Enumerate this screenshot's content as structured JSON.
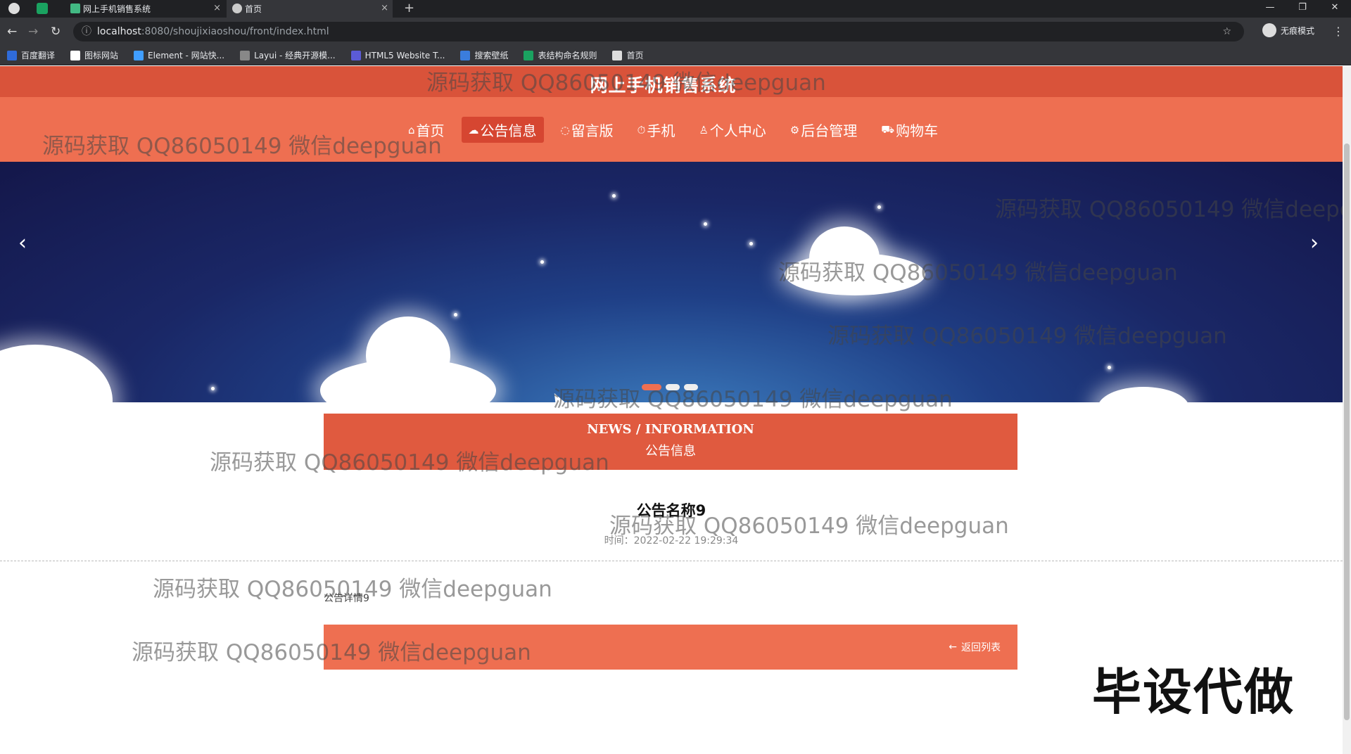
{
  "browser": {
    "tabs": [
      {
        "title": "网上手机销售系统",
        "close": "×"
      },
      {
        "title": "首页",
        "close": "×"
      }
    ],
    "new_tab": "+",
    "url_host": "localhost",
    "url_path": ":8080/shoujixiaoshou/front/index.html",
    "profile_label": "无痕模式",
    "window_controls": [
      "—",
      "❐",
      "✕"
    ],
    "bookmarks": [
      {
        "label": "百度翻译",
        "color": "#2f6bd9"
      },
      {
        "label": "图标网站",
        "color": "#ffffff"
      },
      {
        "label": "Element - 网站快...",
        "color": "#409eff"
      },
      {
        "label": "Layui - 经典开源模...",
        "color": "#888888"
      },
      {
        "label": "HTML5 Website T...",
        "color": "#5b5bd6"
      },
      {
        "label": "搜索壁纸",
        "color": "#3b7ddd"
      },
      {
        "label": "表结构命名规则",
        "color": "#1aa260"
      },
      {
        "label": "首页",
        "color": "#dddddd"
      }
    ]
  },
  "site": {
    "title": "网上手机销售系统",
    "nav": [
      {
        "icon": "⌂",
        "label": "首页",
        "active": false
      },
      {
        "icon": "☁",
        "label": "公告信息",
        "active": true
      },
      {
        "icon": "◌",
        "label": "留言版",
        "active": false
      },
      {
        "icon": "⏱",
        "label": "手机",
        "active": false
      },
      {
        "icon": "♙",
        "label": "个人中心",
        "active": false
      },
      {
        "icon": "⚙",
        "label": "后台管理",
        "active": false
      },
      {
        "icon": "⛟",
        "label": "购物车",
        "active": false
      }
    ],
    "carousel": {
      "prev": "‹",
      "next": "›",
      "slides": 3,
      "active_slide": 1
    }
  },
  "notice": {
    "header_en": "NEWS / INFORMATION",
    "header_zh": "公告信息",
    "title": "公告名称9",
    "time_label": "时间：",
    "time_value": "2022-02-22 19:29:34",
    "detail": "公告详情9",
    "back_label": "返回列表",
    "back_icon": "←"
  },
  "watermarks": {
    "text": "源码获取 QQ86050149 微信deepguan",
    "corner_text": "毕设代做"
  },
  "colors": {
    "header_red": "#d9533a",
    "nav_orange": "#ee6f51",
    "news_red": "#e05a3f"
  }
}
